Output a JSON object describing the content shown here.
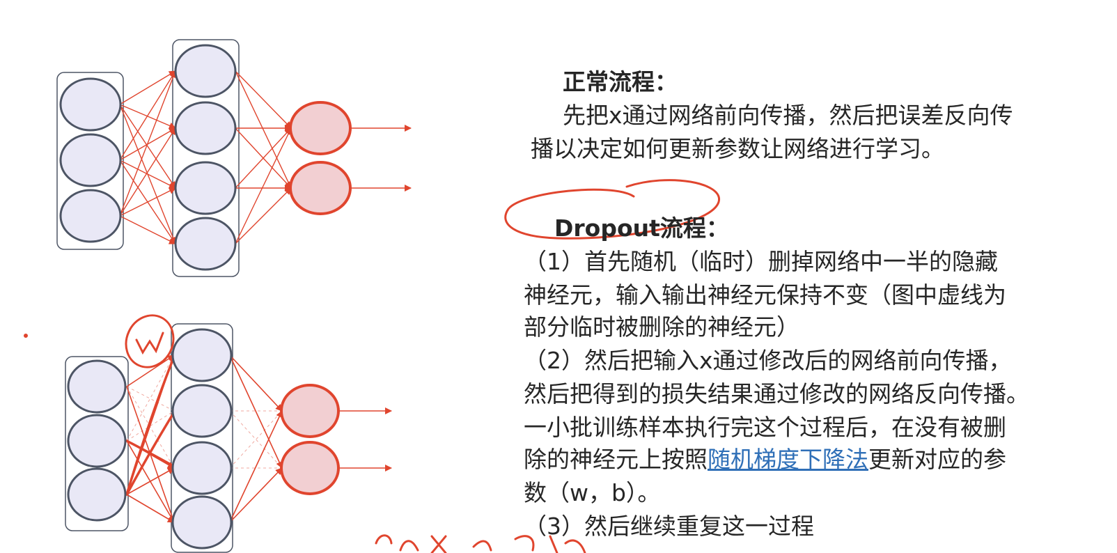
{
  "normal": {
    "heading": "正常流程：",
    "line1": "先把x通过网络前向传播，然后把误差反向传",
    "line2": "播以决定如何更新参数让网络进行学习。"
  },
  "dropout": {
    "heading": "Dropout流程：",
    "step1_line1": "（1）首先随机（临时）删掉网络中一半的隐藏",
    "step1_line2": "神经元，输入输出神经元保持不变（图中虚线为",
    "step1_line3": "部分临时被删除的神经元）",
    "step2_line1": "（2）然后把输入x通过修改后的网络前向传播，",
    "step2_line2": "然后把得到的损失结果通过修改的网络反向传播。",
    "step2_line3": "一小批训练样本执行完这个过程后，在没有被删",
    "step2_line4_pre": "除的神经元上按照",
    "step2_line4_link": "随机梯度下降法",
    "step2_line4_post": "更新对应的参",
    "step2_line5": "数（w，b）。",
    "step3": "（3）然后继续重复这一过程"
  },
  "colors": {
    "accent": "#e0452e",
    "neuron_fill": "#e9e8f6",
    "output_fill": "#f2cfd2",
    "neuron_stroke": "#4d5565",
    "link": "#2f6fb7"
  }
}
